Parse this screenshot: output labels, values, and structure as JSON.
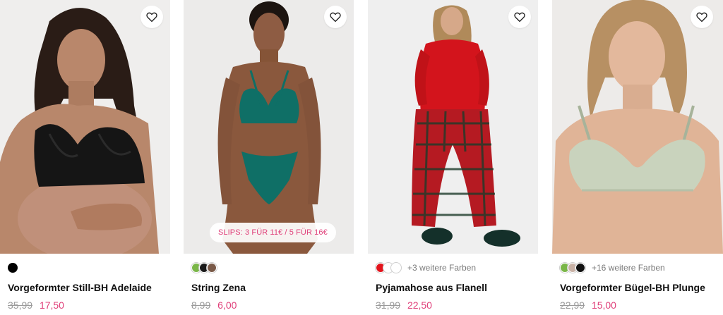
{
  "colors": {
    "sale_price": "#e0407a",
    "old_price": "#9a9a9a",
    "text": "#111111",
    "promo_text": "#e0407a"
  },
  "products": [
    {
      "name": "Vorgeformter Still-BH Adelaide",
      "old_price": "35,99",
      "price": "17,50",
      "swatches": [
        "#000000"
      ],
      "more_colors": "",
      "promo": "",
      "wishlist_icon": "heart-outline-icon"
    },
    {
      "name": "String Zena",
      "old_price": "8,99",
      "price": "6,00",
      "swatches": [
        "#7ab648",
        "#1a1a1a",
        "#7a5a48"
      ],
      "more_colors": "",
      "promo": "SLIPS: 3 FÜR 11€ / 5 FÜR 16€",
      "wishlist_icon": "heart-outline-icon"
    },
    {
      "name": "Pyjamahose aus Flanell",
      "old_price": "31,99",
      "price": "22,50",
      "swatches": [
        "#e3141c",
        "#ffffff",
        "#ffffff"
      ],
      "more_colors": "+3 weitere Farben",
      "promo": "",
      "wishlist_icon": "heart-outline-icon"
    },
    {
      "name": "Vorgeformter Bügel-BH Plunge",
      "old_price": "22,99",
      "price": "15,00",
      "swatches": [
        "#7ab648",
        "#c9b2a6",
        "#111111"
      ],
      "more_colors": "+16 weitere Farben",
      "promo": "",
      "wishlist_icon": "heart-outline-icon"
    }
  ]
}
